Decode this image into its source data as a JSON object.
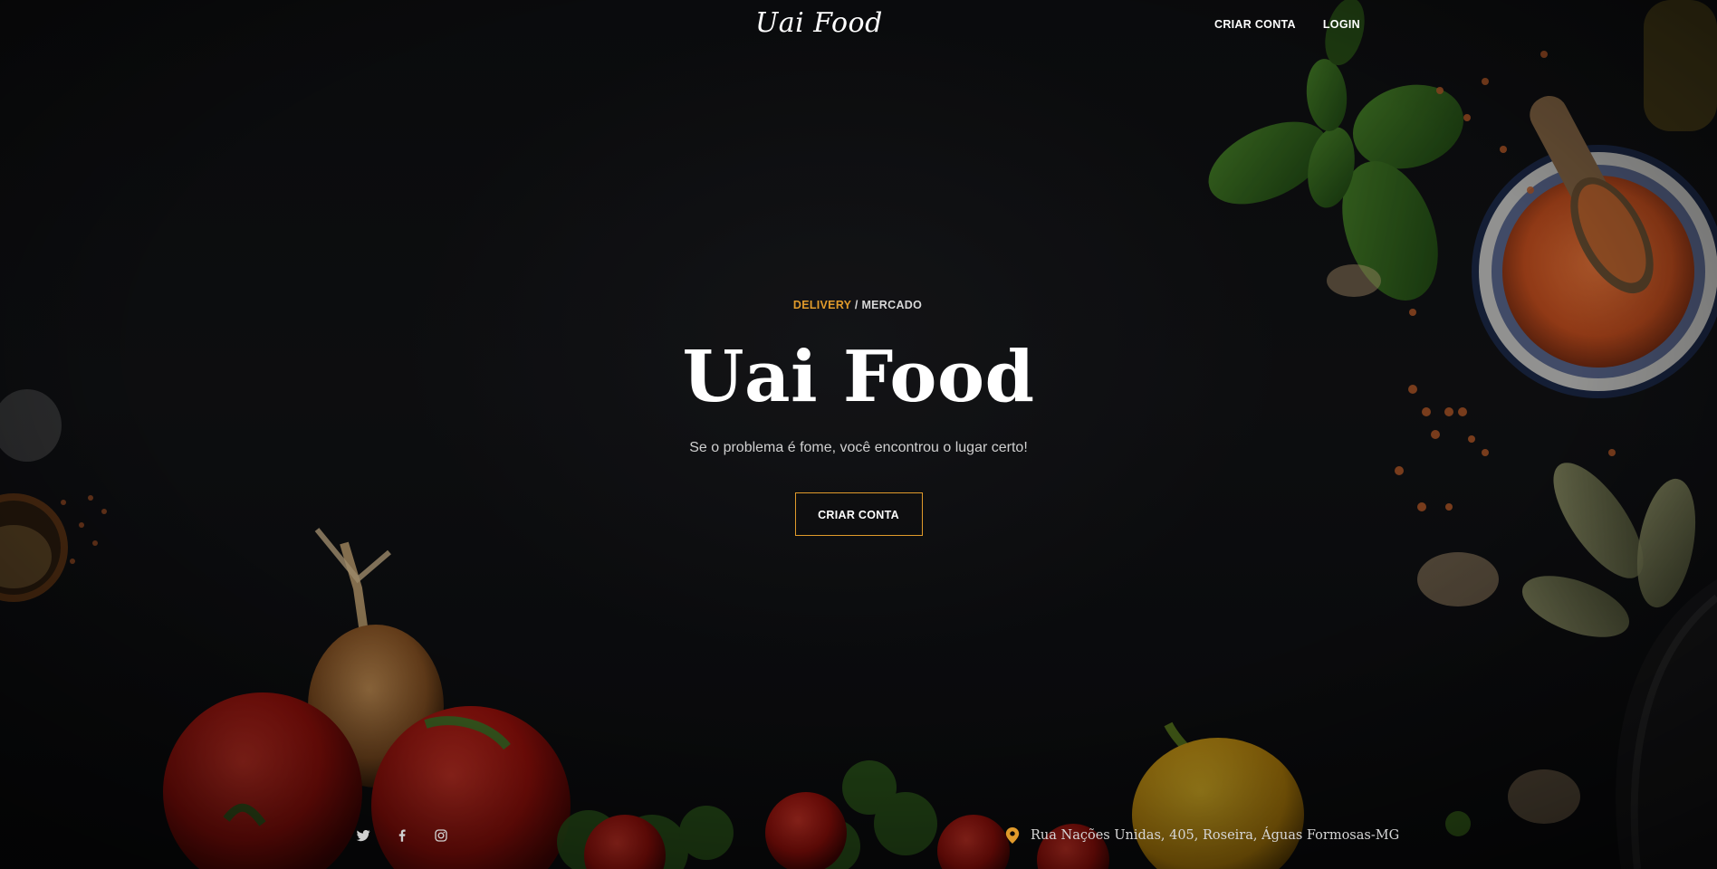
{
  "header": {
    "brand": "Uai Food",
    "nav": {
      "signup_label": "CRIAR CONTA",
      "login_label": "LOGIN"
    }
  },
  "hero": {
    "eyebrow_accent": "DELIVERY",
    "eyebrow_separator": " / ",
    "eyebrow_rest": "MERCADO",
    "title": "Uai Food",
    "subtitle": "Se o problema é fome, você encontrou o lugar certo!",
    "cta_label": "CRIAR CONTA"
  },
  "footer": {
    "social_icons": [
      "twitter-icon",
      "facebook-icon",
      "instagram-icon"
    ],
    "address": "Rua Nações Unidas, 405, Roseira, Águas Formosas-MG"
  },
  "colors": {
    "accent": "#e09a2b",
    "background": "#0f1012",
    "text": "#ffffff",
    "muted_text": "#cfcfcf"
  }
}
